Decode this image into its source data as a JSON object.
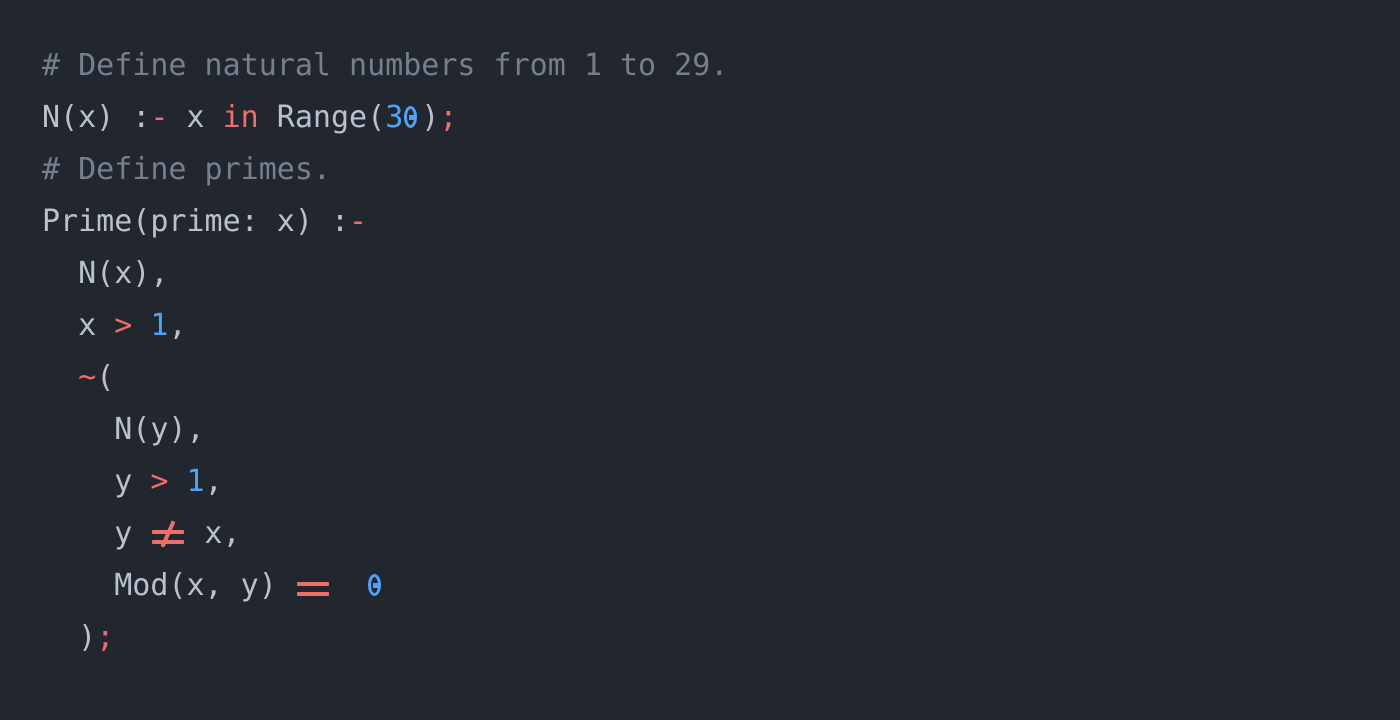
{
  "editor": {
    "background_color": "#22262f",
    "foreground_color": "#b9c1cd",
    "comment_color": "#767f8c",
    "keyword_color": "#ec6f6a",
    "number_color": "#4fa3f7",
    "language": "logic-programming"
  },
  "code": {
    "lines": [
      {
        "index": 1,
        "indent": 0,
        "text": "# Define natural numbers from 1 to 29.",
        "tokens": [
          {
            "t": "# Define natural numbers from 1 to 29.",
            "k": "comment"
          }
        ]
      },
      {
        "index": 2,
        "indent": 0,
        "text": "N(x) :- x in Range(30);",
        "tokens": [
          {
            "t": "N(x) :",
            "k": "ident"
          },
          {
            "t": "-",
            "k": "operator"
          },
          {
            "t": " x ",
            "k": "ident"
          },
          {
            "t": "in",
            "k": "keyword"
          },
          {
            "t": " Range(",
            "k": "ident"
          },
          {
            "t": "3",
            "k": "number"
          },
          {
            "t": "0",
            "k": "zero"
          },
          {
            "t": ")",
            "k": "ident"
          },
          {
            "t": ";",
            "k": "operator"
          }
        ]
      },
      {
        "index": 3,
        "indent": 0,
        "text": "# Define primes.",
        "tokens": [
          {
            "t": "# Define primes.",
            "k": "comment"
          }
        ]
      },
      {
        "index": 4,
        "indent": 0,
        "text": "Prime(prime: x) :-",
        "tokens": [
          {
            "t": "Prime(prime: x) :",
            "k": "ident"
          },
          {
            "t": "-",
            "k": "operator"
          }
        ]
      },
      {
        "index": 5,
        "indent": 2,
        "text": "  N(x),",
        "tokens": [
          {
            "t": "  N(x),",
            "k": "ident"
          }
        ]
      },
      {
        "index": 6,
        "indent": 2,
        "text": "  x > 1,",
        "tokens": [
          {
            "t": "  x ",
            "k": "ident"
          },
          {
            "t": ">",
            "k": "operator"
          },
          {
            "t": " ",
            "k": "ident"
          },
          {
            "t": "1",
            "k": "number"
          },
          {
            "t": ",",
            "k": "ident"
          }
        ]
      },
      {
        "index": 7,
        "indent": 2,
        "text": "  ~(",
        "tokens": [
          {
            "t": "  ",
            "k": "ident"
          },
          {
            "t": "~",
            "k": "operator"
          },
          {
            "t": "(",
            "k": "ident"
          }
        ]
      },
      {
        "index": 8,
        "indent": 4,
        "text": "    N(y),",
        "tokens": [
          {
            "t": "    N(y),",
            "k": "ident"
          }
        ]
      },
      {
        "index": 9,
        "indent": 4,
        "text": "    y > 1,",
        "tokens": [
          {
            "t": "    y ",
            "k": "ident"
          },
          {
            "t": ">",
            "k": "operator"
          },
          {
            "t": " ",
            "k": "ident"
          },
          {
            "t": "1",
            "k": "number"
          },
          {
            "t": ",",
            "k": "ident"
          }
        ]
      },
      {
        "index": 10,
        "indent": 4,
        "text": "    y != x,",
        "tokens": [
          {
            "t": "    y ",
            "k": "ident"
          },
          {
            "t": "!=",
            "k": "lig-ne"
          },
          {
            "t": " x,",
            "k": "ident"
          }
        ]
      },
      {
        "index": 11,
        "indent": 4,
        "text": "    Mod(x, y) == 0",
        "tokens": [
          {
            "t": "    Mod(x, y) ",
            "k": "ident"
          },
          {
            "t": "==",
            "k": "lig-eq"
          },
          {
            "t": "  ",
            "k": "ident"
          },
          {
            "t": "0",
            "k": "zero"
          }
        ]
      },
      {
        "index": 12,
        "indent": 2,
        "text": "  );",
        "tokens": [
          {
            "t": "  )",
            "k": "ident"
          },
          {
            "t": ";",
            "k": "operator"
          }
        ]
      }
    ]
  }
}
